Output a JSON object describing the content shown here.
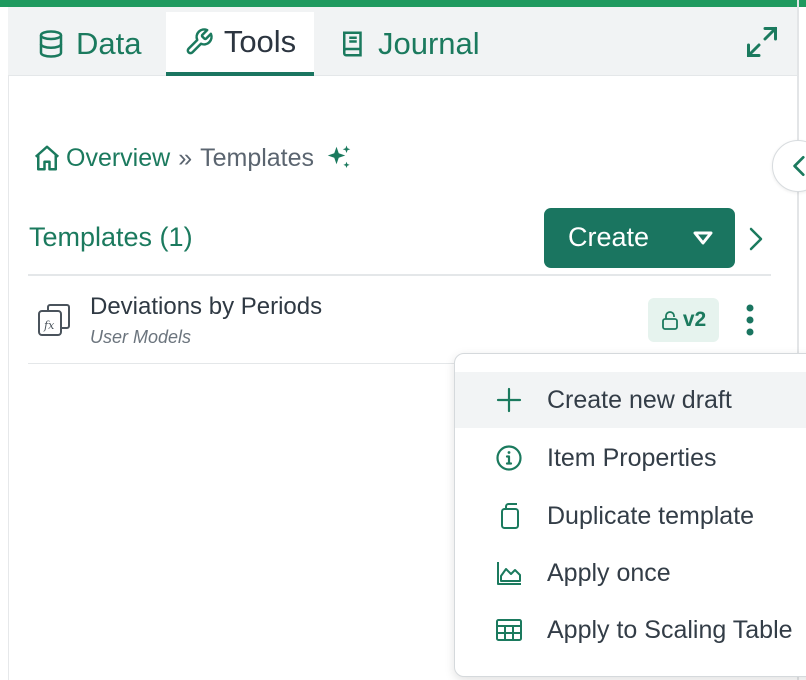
{
  "tabs": [
    {
      "label": "Data",
      "icon": "database-icon",
      "active": false
    },
    {
      "label": "Tools",
      "icon": "wrench-icon",
      "active": true
    },
    {
      "label": "Journal",
      "icon": "book-icon",
      "active": false
    }
  ],
  "breadcrumb": {
    "home_label": "Overview",
    "separator": "»",
    "current": "Templates"
  },
  "section": {
    "title": "Templates (1)",
    "create_label": "Create"
  },
  "template_item": {
    "title": "Deviations by Periods",
    "subtitle": "User Models",
    "version": "v2",
    "icon": "formula-icon"
  },
  "menu": {
    "items": [
      {
        "label": "Create new draft",
        "icon": "plus-icon"
      },
      {
        "label": "Item Properties",
        "icon": "info-icon"
      },
      {
        "label": "Duplicate template",
        "icon": "copy-icon"
      },
      {
        "label": "Apply once",
        "icon": "area-chart-icon"
      },
      {
        "label": "Apply to Scaling Table",
        "icon": "table-icon"
      }
    ]
  },
  "colors": {
    "accent": "#1a7560",
    "link": "#1b7a5e",
    "top_stripe": "#1f9a5f",
    "badge_bg": "#e6f3ee"
  }
}
